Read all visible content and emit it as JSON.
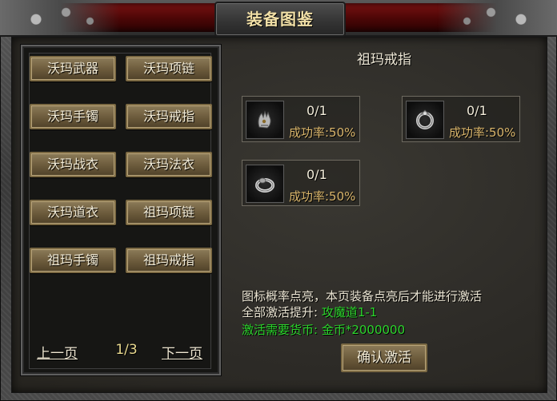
{
  "window": {
    "title": "装备图鉴"
  },
  "equipment_list": {
    "items": [
      {
        "label": "沃玛武器"
      },
      {
        "label": "沃玛项链"
      },
      {
        "label": "沃玛手镯"
      },
      {
        "label": "沃玛戒指"
      },
      {
        "label": "沃玛战衣"
      },
      {
        "label": "沃玛法衣"
      },
      {
        "label": "沃玛道衣"
      },
      {
        "label": "祖玛项链"
      },
      {
        "label": "祖玛手镯"
      },
      {
        "label": "祖玛戒指"
      }
    ],
    "prev_label": "上一页",
    "page_indicator": "1/3",
    "next_label": "下一页"
  },
  "detail": {
    "title": "祖玛戒指",
    "slots": [
      {
        "count": "0/1",
        "rate": "成功率:50%",
        "icon": "gauntlet-icon"
      },
      {
        "count": "0/1",
        "rate": "成功率:50%",
        "icon": "ring-icon"
      },
      {
        "count": "0/1",
        "rate": "成功率:50%",
        "icon": "ring-icon"
      }
    ],
    "hint": "图标概率点亮，本页装备点亮后才能进行激活",
    "bonus_label": "全部激活提升:",
    "bonus_value": "攻魔道1-1",
    "cost_label": "激活需要货币:",
    "cost_value": "金币*2000000",
    "confirm_label": "确认激活"
  },
  "colors": {
    "title_gold": "#f1dfa6",
    "highlight_green": "#2bd42b",
    "rate_gold": "#d9b56b"
  }
}
